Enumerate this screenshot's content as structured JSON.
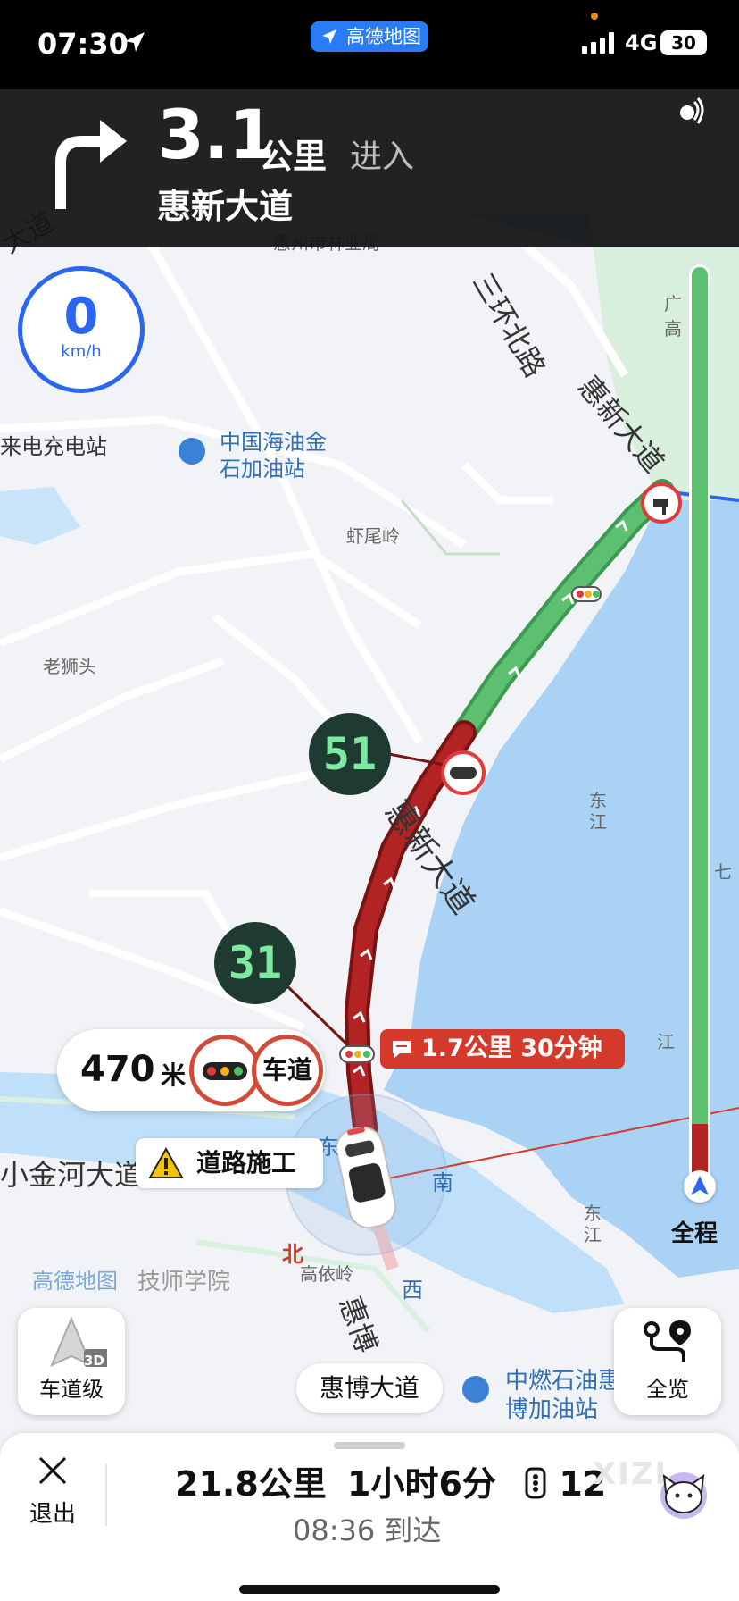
{
  "status_bar": {
    "time": "07:30",
    "network": "4G",
    "battery": "30"
  },
  "app_pill": {
    "label": "高德地图"
  },
  "nav_banner": {
    "distance": "3.1",
    "distance_unit": "公里",
    "action": "进入",
    "road": "惠新大道"
  },
  "speed": {
    "value": "0",
    "unit": "km/h"
  },
  "map_labels": {
    "diag_road": "大道",
    "forestry": "惠州市林业局",
    "ring_road": "三环北路",
    "huixin_vertical": "惠新大道",
    "charge_station": "来电充电站",
    "cnooc": "中国海油金石加油站",
    "xiaweiling": "虾尾岭",
    "laoshitou": "老狮头",
    "route_road": "惠新大道",
    "dongjiang_1": "东江",
    "dongjiang_2": "东江",
    "xiaojinhe": "小金河大道",
    "dong": "东",
    "nan": "南",
    "bei": "北",
    "xi": "西",
    "gaoyiling": "高依岭",
    "amap_wm": "高德地图",
    "technician": "技师学院",
    "huibo_vertical": "惠博",
    "zhongran": "中燃石油惠博加油站",
    "guanghe": "广高",
    "qi": "七",
    "jiang": "江"
  },
  "timers": {
    "t1": "51",
    "t2": "31"
  },
  "lane_info": {
    "distance": "470",
    "unit": "米",
    "lane_label": "车道"
  },
  "jam_tag": {
    "text": "1.7公里 30分钟"
  },
  "construction": {
    "text": "道路施工"
  },
  "progress": {
    "overall_label": "全程",
    "fraction_remaining": 0.94
  },
  "buttons": {
    "lane_level": "车道级",
    "badge_3d": "3D",
    "overview": "全览"
  },
  "road_chip": {
    "text": "惠博大道"
  },
  "bottom": {
    "exit": "退出",
    "summary_dist": "21.8公里",
    "summary_time": "1小时6分",
    "traffic_lights": "12",
    "arrival": "08:36 到达",
    "watermark": "XIZI"
  },
  "colors": {
    "route_green": "#5cc070",
    "route_red": "#b22424",
    "accent_blue": "#2a66f0",
    "jam_red": "#d43a2c"
  }
}
